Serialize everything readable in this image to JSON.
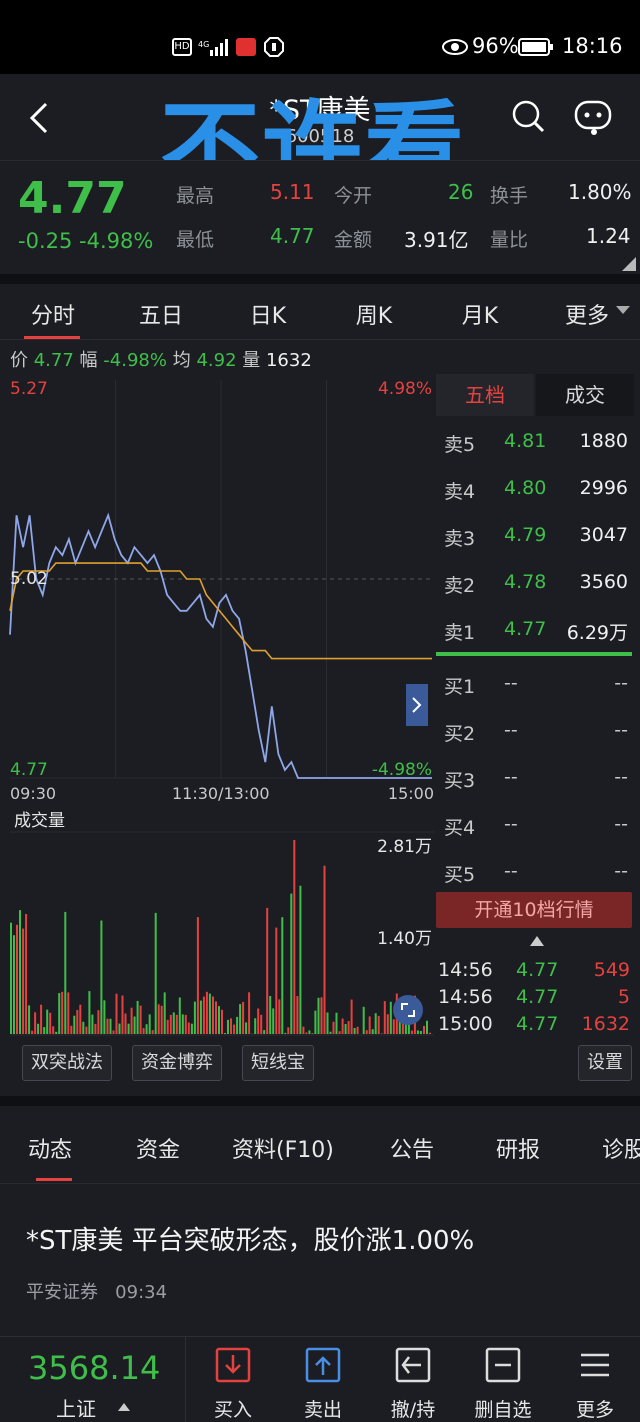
{
  "status_bar": {
    "left_icons": [
      "hd-icon",
      "4g-signal-icon",
      "app-notification-icon",
      "shield-icon"
    ],
    "battery": "96%",
    "time": "18:16"
  },
  "header": {
    "title": "*ST康美",
    "code": "600518",
    "watermark": "不许看"
  },
  "quote": {
    "price": "4.77",
    "change": "-0.25",
    "change_pct": "-4.98%",
    "high_label": "最高",
    "high_value": "5.11",
    "open_label": "今开",
    "open_value": "26",
    "turnover_label": "换手",
    "turnover_value": "1.80%",
    "low_label": "最低",
    "low_value": "4.77",
    "amount_label": "金额",
    "amount_value": "3.91亿",
    "ratio_label": "量比",
    "ratio_value": "1.24"
  },
  "chart_tabs": [
    "分时",
    "五日",
    "日K",
    "周K",
    "月K",
    "更多"
  ],
  "info_line": {
    "price_label": "价",
    "price": "4.77",
    "pct_label": "幅",
    "pct": "-4.98%",
    "avg_label": "均",
    "avg": "4.92",
    "vol_label": "量",
    "vol": "1632"
  },
  "chart_data": {
    "type": "line",
    "y_top_label": "5.27",
    "y_mid_label": "5.02",
    "y_bottom_label": "4.77",
    "pct_top_label": "4.98%",
    "pct_bottom_label": "-4.98%",
    "ylim": [
      4.77,
      5.27
    ],
    "x_labels": [
      "09:30",
      "11:30/13:00",
      "15:00"
    ],
    "series": [
      {
        "color": "#8fa6e8",
        "values": [
          4.95,
          5.1,
          5.06,
          5.1,
          5.02,
          5.0,
          5.04,
          5.06,
          5.05,
          5.07,
          5.04,
          5.06,
          5.08,
          5.06,
          5.08,
          5.1,
          5.07,
          5.05,
          5.04,
          5.06,
          5.05,
          5.04,
          5.05,
          5.03,
          5.0,
          4.99,
          4.98,
          4.98,
          4.99,
          5.0,
          4.97,
          4.96,
          4.99,
          5.0,
          4.98,
          4.97,
          4.93,
          4.88,
          4.83,
          4.79,
          4.86,
          4.8,
          4.78,
          4.79,
          4.77,
          4.77,
          4.77,
          4.77,
          4.77,
          4.77
        ]
      },
      {
        "color": "#e0a030",
        "values": [
          4.98,
          5.02,
          5.03,
          5.03,
          5.03,
          5.03,
          5.03,
          5.04,
          5.04,
          5.04,
          5.04,
          5.04,
          5.04,
          5.04,
          5.04,
          5.04,
          5.04,
          5.04,
          5.04,
          5.04,
          5.04,
          5.03,
          5.03,
          5.03,
          5.03,
          5.03,
          5.03,
          5.02,
          5.02,
          5.02,
          5.0,
          4.99,
          4.98,
          4.97,
          4.96,
          4.95,
          4.94,
          4.93,
          4.93,
          4.93,
          4.92,
          4.92,
          4.92,
          4.92,
          4.92,
          4.92,
          4.92,
          4.92,
          4.92,
          4.92
        ]
      }
    ]
  },
  "volume": {
    "title": "成交量",
    "max_label": "2.81万",
    "mid_label": "1.40万",
    "ylim": [
      0,
      28100
    ]
  },
  "book": {
    "tabs": [
      "五档",
      "成交"
    ],
    "sell": [
      {
        "label": "卖5",
        "price": "4.81",
        "vol": "1880"
      },
      {
        "label": "卖4",
        "price": "4.80",
        "vol": "2996"
      },
      {
        "label": "卖3",
        "price": "4.79",
        "vol": "3047"
      },
      {
        "label": "卖2",
        "price": "4.78",
        "vol": "3560"
      },
      {
        "label": "卖1",
        "price": "4.77",
        "vol": "6.29万"
      }
    ],
    "buy": [
      {
        "label": "买1",
        "price": "--",
        "vol": "--"
      },
      {
        "label": "买2",
        "price": "--",
        "vol": "--"
      },
      {
        "label": "买3",
        "price": "--",
        "vol": "--"
      },
      {
        "label": "买4",
        "price": "--",
        "vol": "--"
      },
      {
        "label": "买5",
        "price": "--",
        "vol": "--"
      }
    ],
    "open10": "开通10档行情",
    "trades": [
      {
        "time": "14:56",
        "price": "4.77",
        "vol": "549"
      },
      {
        "time": "14:56",
        "price": "4.77",
        "vol": "5"
      },
      {
        "time": "15:00",
        "price": "4.77",
        "vol": "1632"
      }
    ]
  },
  "indicators": [
    "双突战法",
    "资金博弈",
    "短线宝"
  ],
  "settings_label": "设置",
  "news_tabs": [
    "动态",
    "资金",
    "资料(F10)",
    "公告",
    "研报",
    "诊股"
  ],
  "news": {
    "title": "*ST康美 平台突破形态，股价涨1.00%",
    "source": "平安证券",
    "time": "09:34"
  },
  "bottom_bar": {
    "index_value": "3568.14",
    "index_name": "上证",
    "buttons": [
      "买入",
      "卖出",
      "撤/持",
      "删自选",
      "更多"
    ]
  },
  "colors": {
    "up": "#e5423f",
    "down": "#3fbf4a",
    "price_line": "#8fa6e8",
    "avg_line": "#e0a030",
    "watermark": "#2a8fe6"
  }
}
